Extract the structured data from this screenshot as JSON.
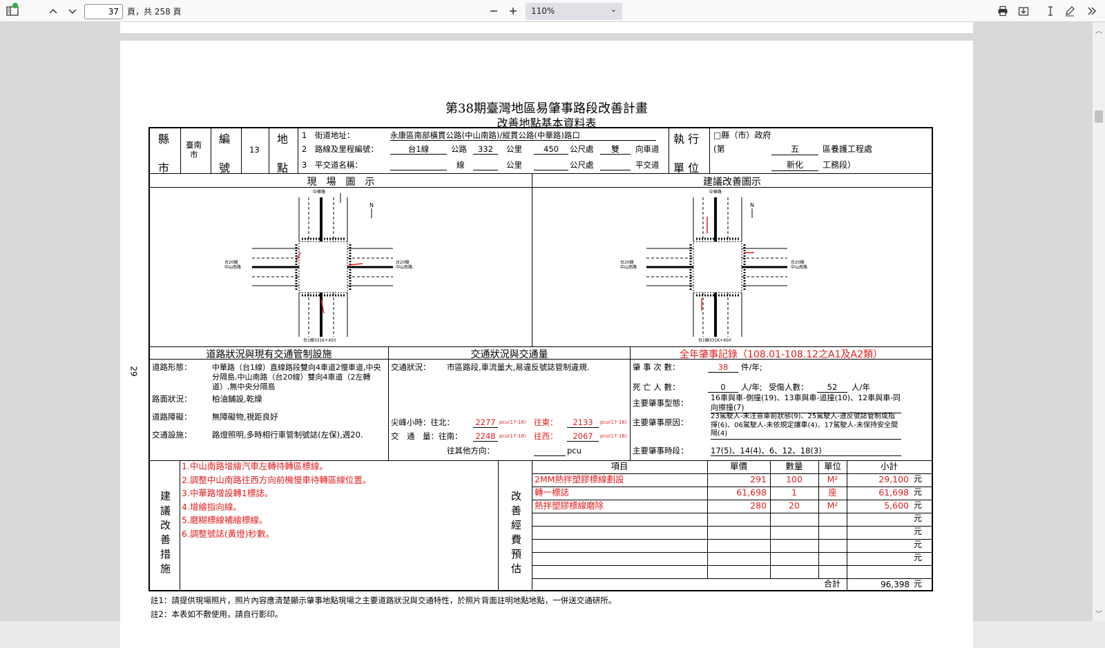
{
  "toolbar": {
    "page_current": "37",
    "page_total_text": "頁，共 258 頁",
    "zoom": "110%"
  },
  "doc": {
    "title": "第38期臺灣地區易肇事路段改善計畫",
    "subtitle": "改善地點基本資料表",
    "page_number": "29",
    "hdr": {
      "county_label_1": "縣",
      "county_label_2": "市",
      "county_value_1": "臺南",
      "county_value_2": "市",
      "code_label_1": "編",
      "code_label_2": "號",
      "code_value": "13",
      "loc_label_1": "地",
      "loc_label_2": "點",
      "row1_label": "1　街道地址：",
      "row1_value": "永康區南部橫貫公路(中山南路)/縱貫公路(中華路)路口",
      "row2_label": "2　路線及里程編號：",
      "row2_route": "台1線",
      "row2_word_road": "公路",
      "row2_km": "332",
      "row2_word_km": "公里",
      "row2_m": "450",
      "row2_word_m": "公尺處",
      "row2_dir": "雙",
      "row2_word_dir": "向車道",
      "row3_label": "3　平交道名稱：",
      "row3_word_line": "線",
      "row3_word_road": "公路",
      "row3_word_km": "公里",
      "row3_word_m": "公尺處",
      "row3_word_rail": "平交道",
      "unit_label_1": "執 行",
      "unit_label_2": "單 位",
      "unit_line1": "□縣（市）政府",
      "unit_line2_a": "(第",
      "unit_line2_b": "五",
      "unit_line2_c": "區養護工程處",
      "unit_line3_b": "新化",
      "unit_line3_c": "工務段）"
    },
    "diagrams": {
      "left_title": "現　場　圖　示",
      "right_title": "建議改善圖示",
      "north": "N",
      "road_top": "中華路",
      "road_left": "台20線",
      "road_left2": "中山南路",
      "road_right": "台20線",
      "road_right2": "中山南路",
      "road_bottom": "台1線331K+450"
    },
    "road": {
      "title": "道路狀況與現有交通管制設施",
      "form_label": "道路形態：",
      "form_value": "中華路（台1線）直線路段雙向4車道2慢車道,中央分隔島,中山南路（台20線）雙向4車道（2左轉道）,無中央分隔島",
      "surface_label": "路面狀況：",
      "surface_value": "柏油舖設,乾燥",
      "obstacle_label": "道路障礙：",
      "obstacle_value": "無障礙物,視距良好",
      "facility_label": "交通設施：",
      "facility_value": "路燈照明,多時相行車管制號誌(左保),週20."
    },
    "traffic": {
      "title": "交通狀況與交通量",
      "status_label": "交通狀況：",
      "status_value": "市區路段,車流量大,易違反號誌管制違規.",
      "peak_label": "尖峰小時：往北：",
      "north_value": "2277",
      "unit": "pcu(17-18)",
      "east_label": "往東：",
      "east_value": "2133",
      "volume_label": "交　通　量：往南：",
      "south_value": "2248",
      "west_label": "往西：",
      "west_value": "2067",
      "other_label": "往其他方向：",
      "other_unit": "pcu"
    },
    "accident": {
      "title": "全年肇事記錄（108.01-108.12之A1及A2類）",
      "count_label": "肇 事 次 數：",
      "count_value": "38",
      "count_unit": "件/年;",
      "death_label": "死 亡 人 數：",
      "death_value": "0",
      "death_unit": "人/年;",
      "injury_label": "受傷人數：",
      "injury_value": "52",
      "injury_unit": "人/年",
      "type_label": "主要肇事型態：",
      "type_value": "16車與車-側撞(19)、13車與車-追撞(10)、12車與車-同向擦撞(7)",
      "cause_label": "主要肇事原因：",
      "cause_value": "23駕駛人-未注意車前狀態(9)、25駕駛人-違反號誌管制或指揮(6)、06駕駛人-未依規定讓車(4)、17駕駛人-未保持安全間隔(4)",
      "time_label": "主要肇事時段：",
      "time_value": "17(5)、14(4)、6、12、18(3)"
    },
    "measures": {
      "label": "建議改善措施",
      "items": [
        "1.中山南路增繪汽車左轉待轉區標線。",
        "2.調整中山南路往西方向前機慢車待轉區線位置。",
        "3.中華路增設轉1標誌。",
        "4.增繪指向線。",
        "5.磨糊標線補繪標線。",
        "6.調整號誌(黃燈)秒數。"
      ]
    },
    "budget": {
      "label": "改善經費預估",
      "headers": [
        "項目",
        "單價",
        "數量",
        "單位",
        "小計"
      ],
      "rows": [
        {
          "item": "2MM熱拌塑膠標線劃設",
          "price": "291",
          "qty": "100",
          "unit": "M²",
          "subtotal": "29,100"
        },
        {
          "item": "轉一標誌",
          "price": "61,698",
          "qty": "1",
          "unit": "座",
          "subtotal": "61,698"
        },
        {
          "item": "熱拌塑膠標線磨除",
          "price": "280",
          "qty": "20",
          "unit": "M²",
          "subtotal": "5,600"
        },
        {
          "item": "",
          "price": "",
          "qty": "",
          "unit": "",
          "subtotal": ""
        },
        {
          "item": "",
          "price": "",
          "qty": "",
          "unit": "",
          "subtotal": ""
        },
        {
          "item": "",
          "price": "",
          "qty": "",
          "unit": "",
          "subtotal": ""
        },
        {
          "item": "",
          "price": "",
          "qty": "",
          "unit": "",
          "subtotal": ""
        }
      ],
      "currency": "元",
      "total_label": "合計",
      "total_value": "96,398"
    },
    "notes": [
      "註1：請提供現場照片，照片內容應清楚顯示肇事地點現場之主要道路狀況與交通特性，於照片背面註明地點地點，一併送交通研所。",
      "註2：本表如不敷使用，請自行影印。"
    ]
  }
}
